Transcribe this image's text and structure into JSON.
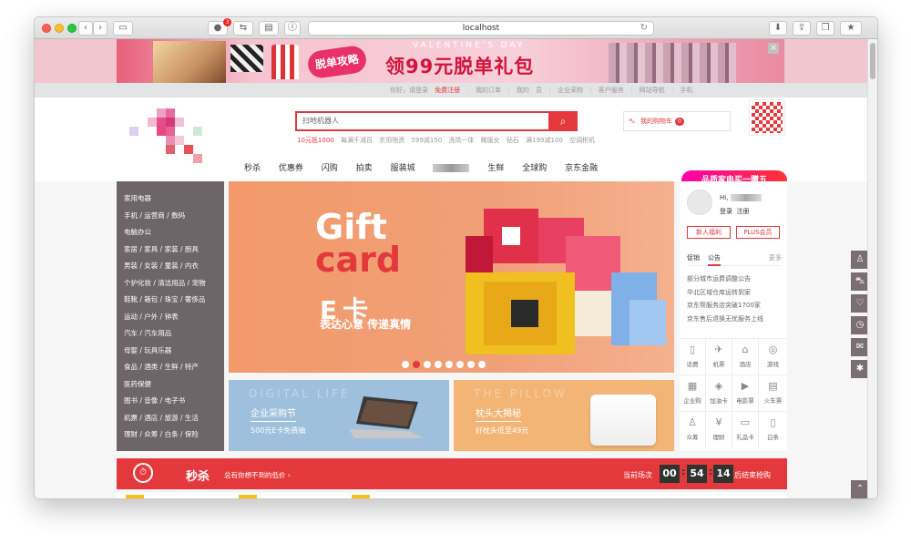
{
  "browser": {
    "url": "localhost",
    "adblock_count": "3",
    "reload_icon": "reload-icon"
  },
  "valentine_banner": {
    "tag": "脱单攻略",
    "subtitle": "VALENTINE'S DAY",
    "headline": "领99元脱单礼包",
    "close": "×"
  },
  "topnav": {
    "greeting": "你好，请登录",
    "register": "免费注册",
    "orders": "我的订单",
    "my": "我的",
    "member": "员",
    "enterprise": "企业采购",
    "service": "客户服务",
    "sitenav": "网站导航",
    "mobile": "手机"
  },
  "search": {
    "placeholder": "扫地机器人",
    "hotwords": [
      "10元抵1000",
      "每满千减百",
      "农用物资",
      "599减150",
      "洗烘一体",
      "稀服女",
      "钻石",
      "满199减100",
      "空调柜机"
    ]
  },
  "cart": {
    "label": "我的购物车",
    "count": "0"
  },
  "mainnav": [
    "秒杀",
    "优惠券",
    "闪购",
    "拍卖",
    "服装城",
    "生鲜",
    "全球购",
    "京东金融"
  ],
  "promo_badge": "品质家电买一赠五",
  "categories": [
    "家用电器",
    "手机 / 运营商 / 数码",
    "电脑办公",
    "家居 / 家具 / 家装 / 厨具",
    "男装 / 女装 / 童装 / 内衣",
    "个护化妆 / 清洁用品 / 宠物",
    "鞋靴 / 箱包 / 珠宝 / 奢侈品",
    "运动 / 户外 / 钟表",
    "汽车 / 汽车用品",
    "母婴 / 玩具乐器",
    "食品 / 酒类 / 生鲜 / 特产",
    "医药保健",
    "图书 / 音像 / 电子书",
    "机票 / 酒店 / 旅游 / 生活",
    "理财 / 众筹 / 白条 / 保险"
  ],
  "carousel": {
    "line1": "Gift",
    "line2": "card",
    "line3": "E卡",
    "slogan": "表达心意 传递真情",
    "dots": 8,
    "active_dot": 2
  },
  "sub_banners": [
    {
      "watermark": "DIGITAL LIFE",
      "title": "企业采购节",
      "desc": "500元E卡免费抽"
    },
    {
      "watermark": "THE PILLOW",
      "title": "枕头大揭秘",
      "desc": "好枕头低至49元"
    }
  ],
  "user": {
    "hi": "Hi,",
    "login": "登录",
    "register": "注册",
    "btn_new": "新人福利",
    "btn_plus": "PLUS会员",
    "tab_promo": "促销",
    "tab_notice": "公告",
    "more": "更多",
    "news": [
      "部分城市运费调整公告",
      "华北区域仓库运转到家",
      "京东帮服务店突破1700家",
      "京东售后退换无忧服务上线"
    ]
  },
  "services": [
    {
      "icon": "phone-icon",
      "glyph": "▯",
      "label": "话费"
    },
    {
      "icon": "plane-icon",
      "glyph": "✈",
      "label": "机票"
    },
    {
      "icon": "hotel-icon",
      "glyph": "⌂",
      "label": "酒店"
    },
    {
      "icon": "gamepad-icon",
      "glyph": "◎",
      "label": "游戏"
    },
    {
      "icon": "enterprise-icon",
      "glyph": "▦",
      "label": "企业购"
    },
    {
      "icon": "fuel-icon",
      "glyph": "◈",
      "label": "加油卡"
    },
    {
      "icon": "movie-icon",
      "glyph": "▶",
      "label": "电影票"
    },
    {
      "icon": "train-icon",
      "glyph": "▤",
      "label": "火车票"
    },
    {
      "icon": "crowdfund-icon",
      "glyph": "♙",
      "label": "众筹"
    },
    {
      "icon": "finance-icon",
      "glyph": "¥",
      "label": "理财"
    },
    {
      "icon": "giftcard-icon",
      "glyph": "▭",
      "label": "礼品卡"
    },
    {
      "icon": "baitiao-icon",
      "glyph": "▯",
      "label": "白条"
    }
  ],
  "seckill": {
    "title": "秒杀",
    "subtitle": "总有你想不到的低价 ›",
    "current": "当前场次",
    "h": "00",
    "m": "54",
    "s": "14",
    "end": "后结束抢购"
  },
  "right_toolbar": [
    {
      "icon": "user-icon",
      "glyph": "♙"
    },
    {
      "icon": "cart-icon",
      "glyph": "⛍"
    },
    {
      "icon": "heart-icon",
      "glyph": "♡"
    },
    {
      "icon": "history-icon",
      "glyph": "◷"
    },
    {
      "icon": "message-icon",
      "glyph": "✉"
    },
    {
      "icon": "share-icon",
      "glyph": "✱"
    }
  ],
  "colors": {
    "accent": "#e4393c",
    "category_bg": "#6e6568",
    "carousel_bg": "#f29a6a"
  }
}
